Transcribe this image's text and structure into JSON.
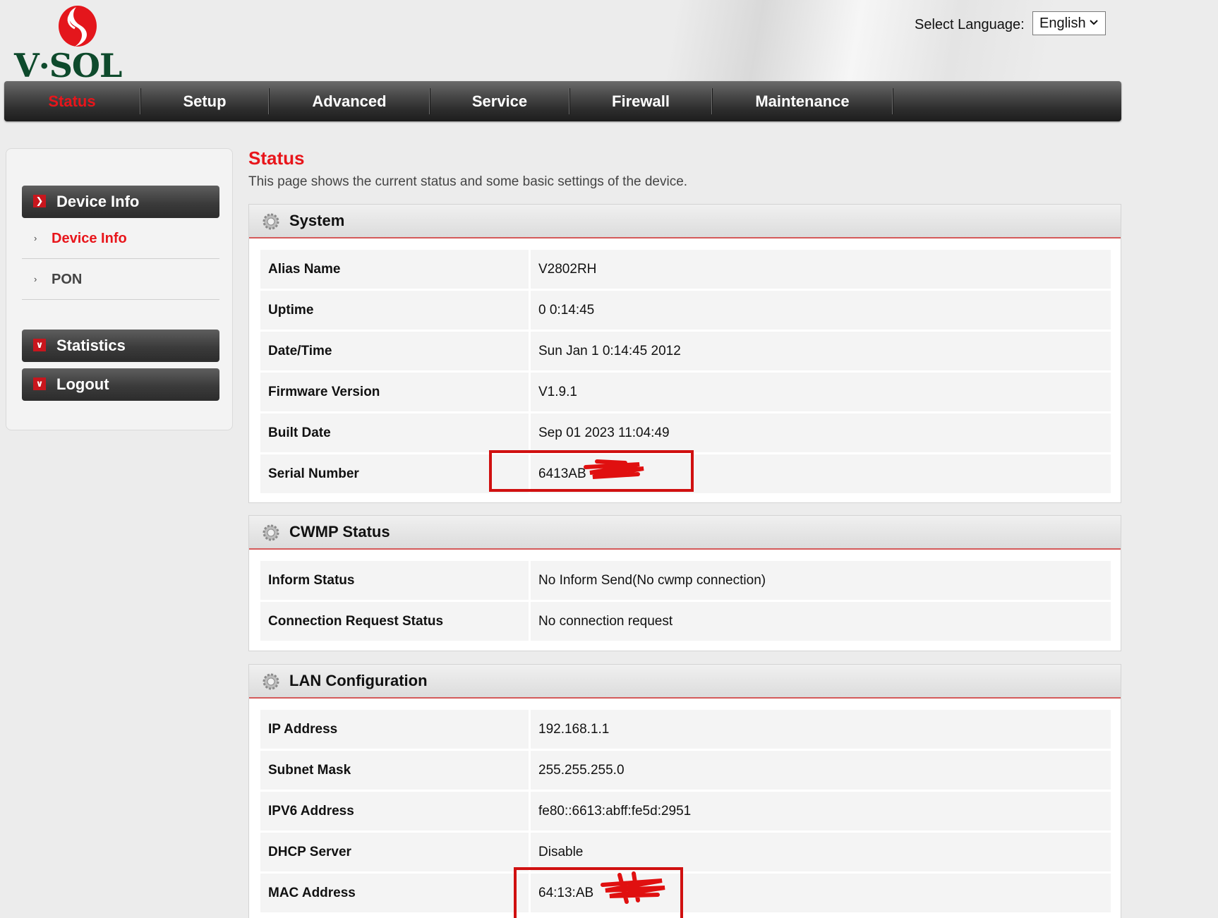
{
  "header": {
    "logo_text": "V·SOL",
    "language_label": "Select Language:",
    "language_value": "English"
  },
  "nav": {
    "items": [
      {
        "label": "Status",
        "active": true
      },
      {
        "label": "Setup"
      },
      {
        "label": "Advanced"
      },
      {
        "label": "Service"
      },
      {
        "label": "Firewall"
      },
      {
        "label": "Maintenance"
      }
    ]
  },
  "sidebar": {
    "device_info_header": "Device Info",
    "device_info_items": [
      {
        "label": "Device Info",
        "active": true
      },
      {
        "label": "PON"
      }
    ],
    "statistics_header": "Statistics",
    "logout_header": "Logout"
  },
  "main": {
    "title": "Status",
    "description": "This page shows the current status and some basic settings of the device."
  },
  "system": {
    "title": "System",
    "rows": [
      {
        "key": "Alias Name",
        "value": "V2802RH"
      },
      {
        "key": "Uptime",
        "value": "0 0:14:45"
      },
      {
        "key": "Date/Time",
        "value": "Sun Jan 1 0:14:45 2012"
      },
      {
        "key": "Firmware Version",
        "value": "V1.9.1"
      },
      {
        "key": "Built Date",
        "value": "Sep 01 2023 11:04:49"
      },
      {
        "key": "Serial Number",
        "value": "6413AB"
      }
    ]
  },
  "cwmp": {
    "title": "CWMP Status",
    "rows": [
      {
        "key": "Inform Status",
        "value": "No Inform Send(No cwmp connection)"
      },
      {
        "key": "Connection Request Status",
        "value": "No connection request"
      }
    ]
  },
  "lan": {
    "title": "LAN Configuration",
    "rows": [
      {
        "key": "IP Address",
        "value": "192.168.1.1"
      },
      {
        "key": "Subnet Mask",
        "value": "255.255.255.0"
      },
      {
        "key": "IPV6 Address",
        "value": "fe80::6613:abff:fe5d:2951"
      },
      {
        "key": "DHCP Server",
        "value": "Disable"
      },
      {
        "key": "MAC Address",
        "value": "64:13:AB"
      }
    ]
  },
  "colors": {
    "accent_red": "#e8151b",
    "logo_green": "#0e4a2c",
    "annotation_red": "#d01010"
  },
  "icons": [
    "vsol-logo-icon",
    "chevron-down-icon",
    "gear-icon",
    "expand-right-icon",
    "collapse-down-icon",
    "bullet-arrow-icon"
  ]
}
